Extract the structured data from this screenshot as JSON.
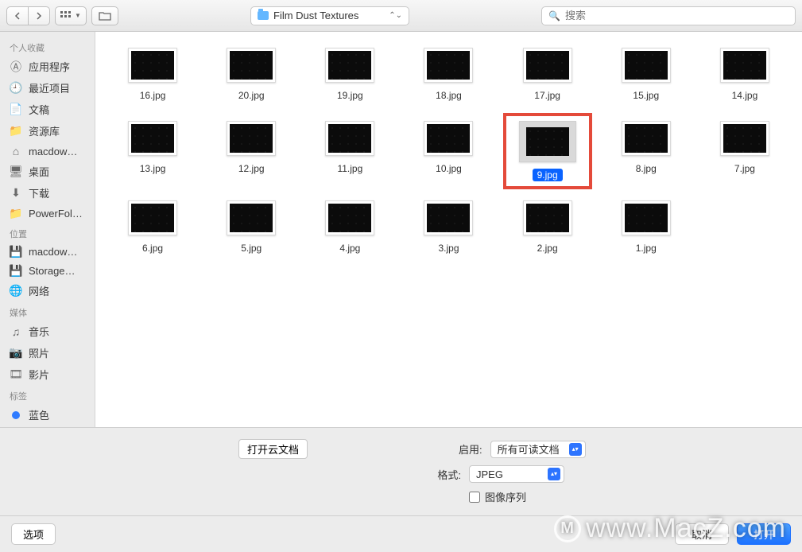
{
  "toolbar": {
    "folder_name": "Film Dust Textures",
    "search_placeholder": "搜索"
  },
  "sidebar": {
    "sections": [
      {
        "title": "个人收藏",
        "items": [
          {
            "icon": "app",
            "label": "应用程序"
          },
          {
            "icon": "recent",
            "label": "最近项目"
          },
          {
            "icon": "docs",
            "label": "文稿"
          },
          {
            "icon": "folder",
            "label": "资源库"
          },
          {
            "icon": "home",
            "label": "macdow…"
          },
          {
            "icon": "desktop",
            "label": "桌面"
          },
          {
            "icon": "download",
            "label": "下载"
          },
          {
            "icon": "folder",
            "label": "PowerFol…"
          }
        ]
      },
      {
        "title": "位置",
        "items": [
          {
            "icon": "disk",
            "label": "macdow…"
          },
          {
            "icon": "disk",
            "label": "Storage…"
          },
          {
            "icon": "globe",
            "label": "网络"
          }
        ]
      },
      {
        "title": "媒体",
        "items": [
          {
            "icon": "music",
            "label": "音乐"
          },
          {
            "icon": "photo",
            "label": "照片"
          },
          {
            "icon": "movie",
            "label": "影片"
          }
        ]
      },
      {
        "title": "标签",
        "items": [
          {
            "icon": "tag-blue",
            "label": "蓝色"
          }
        ]
      }
    ]
  },
  "files": [
    {
      "name": "16.jpg"
    },
    {
      "name": "20.jpg"
    },
    {
      "name": "19.jpg"
    },
    {
      "name": "18.jpg"
    },
    {
      "name": "17.jpg"
    },
    {
      "name": "15.jpg"
    },
    {
      "name": "14.jpg"
    },
    {
      "name": "13.jpg"
    },
    {
      "name": "12.jpg"
    },
    {
      "name": "11.jpg"
    },
    {
      "name": "10.jpg"
    },
    {
      "name": "9.jpg",
      "selected": true,
      "highlighted": true
    },
    {
      "name": "8.jpg"
    },
    {
      "name": "7.jpg"
    },
    {
      "name": "6.jpg"
    },
    {
      "name": "5.jpg"
    },
    {
      "name": "4.jpg"
    },
    {
      "name": "3.jpg"
    },
    {
      "name": "2.jpg"
    },
    {
      "name": "1.jpg"
    }
  ],
  "lower": {
    "cloud_button": "打开云文档",
    "enable_label": "启用:",
    "enable_value": "所有可读文档",
    "format_label": "格式:",
    "format_value": "JPEG",
    "sequence_label": "图像序列"
  },
  "footer": {
    "options": "选项",
    "cancel": "取消",
    "open": "打开"
  },
  "watermark": "www.MacZ.com",
  "colors": {
    "accent": "#0a63ff",
    "highlight": "#e44a3a",
    "tag_blue": "#2f7bff"
  }
}
